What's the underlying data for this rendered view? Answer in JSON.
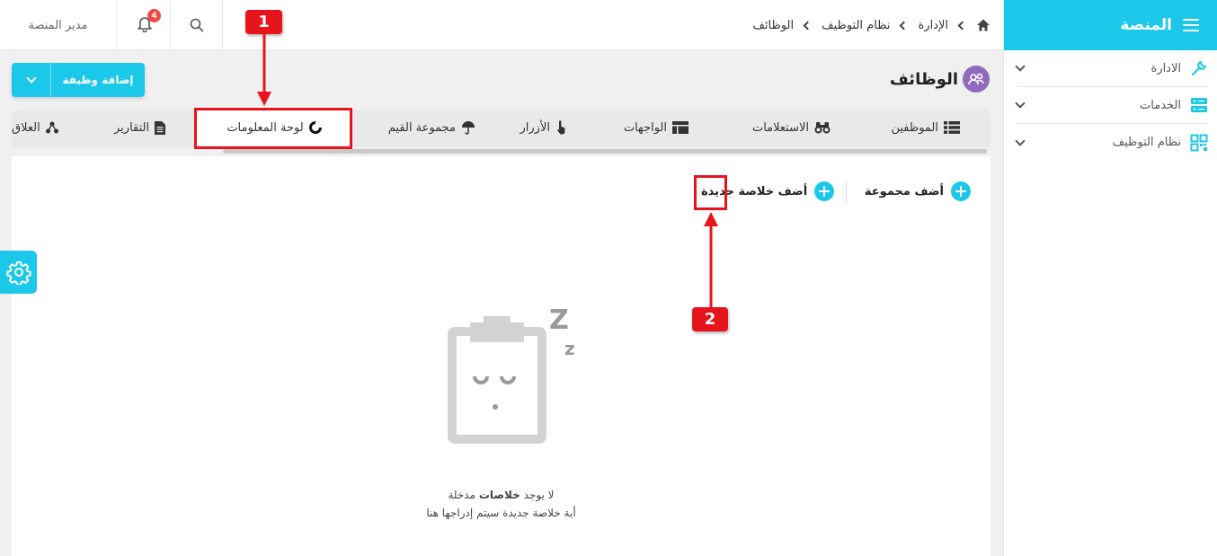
{
  "sidebar": {
    "title": "المنصة",
    "items": [
      {
        "label": "الادارة",
        "icon": "wrench-icon"
      },
      {
        "label": "الخدمات",
        "icon": "server-icon"
      },
      {
        "label": "نظام التوظيف",
        "icon": "qr-grid-icon"
      }
    ]
  },
  "topbar": {
    "user": "مدير المنصة",
    "notifications_count": "4",
    "breadcrumb": [
      "الإدارة",
      "نظام التوظيف",
      "الوظائف"
    ]
  },
  "page": {
    "title": "الوظائف",
    "add_job_label": "إضافة وظيفة"
  },
  "tabs": [
    {
      "label": "الموظفين",
      "icon": "list-icon"
    },
    {
      "label": "الاستعلامات",
      "icon": "binoculars-icon"
    },
    {
      "label": "الواجهات",
      "icon": "layout-icon"
    },
    {
      "label": "الأزرار",
      "icon": "pointer-icon"
    },
    {
      "label": "مجموعة القيم",
      "icon": "umbrella-icon"
    },
    {
      "label": "لوحة المعلومات",
      "icon": "pie-chart-icon",
      "active": true
    },
    {
      "label": "التقارير",
      "icon": "document-icon"
    },
    {
      "label": "العلاق",
      "icon": "share-nodes-icon"
    }
  ],
  "content": {
    "add_group": "أضف مجموعة",
    "add_summary": "أضف خلاصة جديدة",
    "empty_line1_pre": "لا يوجد",
    "empty_line1_bold": "خلاصات",
    "empty_line1_post": "مدخلة",
    "empty_line2": "أية خلاصة جديدة سيتم إدراجها هنا"
  },
  "annotations": [
    {
      "label": "1"
    },
    {
      "label": "2"
    }
  ],
  "colors": {
    "accent": "#1cc8ea",
    "annotation": "#e8141c",
    "title_icon": "#8e6bbf"
  }
}
